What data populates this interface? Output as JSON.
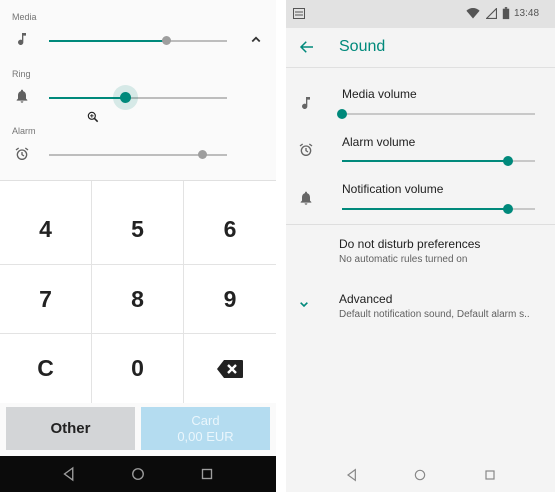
{
  "left": {
    "volume": {
      "media": {
        "label": "Media",
        "level": 0.66,
        "icon": "music-note-icon"
      },
      "ring": {
        "label": "Ring",
        "level": 0.43,
        "icon": "bell-icon"
      },
      "alarm": {
        "label": "Alarm",
        "level": 0.86,
        "icon": "alarm-clock-icon"
      }
    },
    "keypad": {
      "keys": [
        "4",
        "5",
        "6",
        "7",
        "8",
        "9",
        "C",
        "0",
        "⌫"
      ]
    },
    "buttons": {
      "other": "Other",
      "card_label": "Card",
      "card_amount": "0,00 EUR"
    }
  },
  "right": {
    "status": {
      "time": "13:48"
    },
    "title": "Sound",
    "media_volume": {
      "label": "Media volume",
      "level": 0.0
    },
    "alarm_volume": {
      "label": "Alarm volume",
      "level": 0.86
    },
    "notification_volume": {
      "label": "Notification volume",
      "level": 0.86
    },
    "dnd": {
      "title": "Do not disturb preferences",
      "subtitle": "No automatic rules turned on"
    },
    "advanced": {
      "title": "Advanced",
      "subtitle": "Default notification sound, Default alarm s.."
    }
  },
  "colors": {
    "accent": "#00897b",
    "card_button": "#b4dcf0",
    "other_button": "#d3d5d7"
  }
}
